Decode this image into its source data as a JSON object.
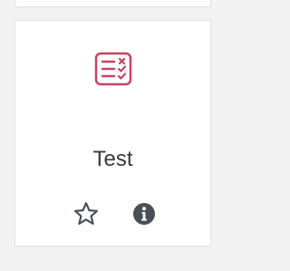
{
  "card": {
    "title": "Test",
    "activity_icon": "quiz-checklist-icon",
    "actions": {
      "favorite_icon": "star-outline-icon",
      "info_icon": "info-circle-icon"
    }
  },
  "colors": {
    "accent": "#c64462",
    "icon_gray": "#4a4f55",
    "text": "#3a3a3a",
    "background": "#f2f2f2",
    "card": "#ffffff"
  }
}
